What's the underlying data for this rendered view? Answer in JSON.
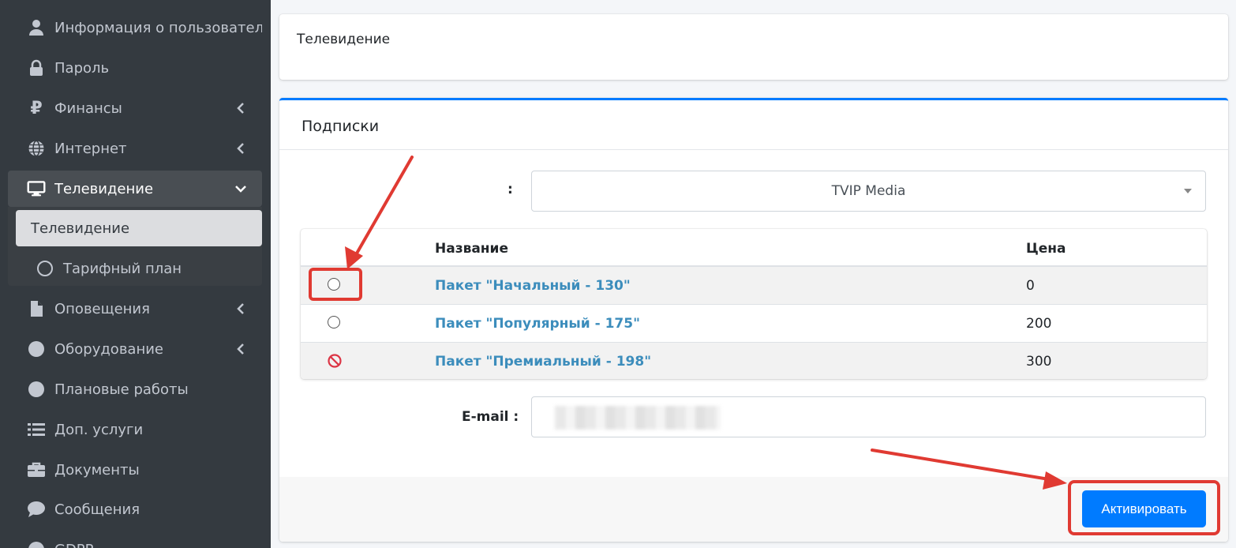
{
  "sidebar": {
    "items": [
      {
        "label": "Информация о пользователе",
        "icon": "user-icon",
        "has_chevron": false
      },
      {
        "label": "Пароль",
        "icon": "lock-icon",
        "has_chevron": false
      },
      {
        "label": "Финансы",
        "icon": "ruble-icon",
        "has_chevron": true
      },
      {
        "label": "Интернет",
        "icon": "globe-icon",
        "has_chevron": true
      },
      {
        "label": "Телевидение",
        "icon": "monitor-icon",
        "has_chevron": true,
        "expanded": true,
        "active": true
      },
      {
        "label": "Оповещения",
        "icon": "file-icon",
        "has_chevron": true
      },
      {
        "label": "Оборудование",
        "icon": "circle-icon",
        "has_chevron": true
      },
      {
        "label": "Плановые работы",
        "icon": "circle-icon",
        "has_chevron": false
      },
      {
        "label": "Доп. услуги",
        "icon": "list-icon",
        "has_chevron": false
      },
      {
        "label": "Документы",
        "icon": "briefcase-icon",
        "has_chevron": false
      },
      {
        "label": "Сообщения",
        "icon": "comment-icon",
        "has_chevron": false
      },
      {
        "label": "GDPR",
        "icon": "circle-icon",
        "has_chevron": false
      }
    ],
    "submenu": [
      {
        "label": "Телевидение",
        "active": true
      },
      {
        "label": "Тарифный план",
        "icon": "ring-icon"
      }
    ]
  },
  "breadcrumb_card": {
    "title": "Телевидение"
  },
  "subscriptions": {
    "title": "Подписки",
    "select_label": ":",
    "select_value": "TVIP Media",
    "table": {
      "headers": {
        "name": "Название",
        "price": "Цена"
      },
      "rows": [
        {
          "state": "radio",
          "name": "Пакет \"Начальный - 130\"",
          "price": "0"
        },
        {
          "state": "radio",
          "name": "Пакет \"Популярный - 175\"",
          "price": "200"
        },
        {
          "state": "blocked",
          "name": "Пакет \"Премиальный - 198\"",
          "price": "300"
        }
      ]
    },
    "email_label": "E-mail :",
    "email_value": "",
    "activate_label": "Активировать"
  },
  "colors": {
    "sidebar_bg": "#343a40",
    "accent": "#007bff",
    "link": "#3c8dbc",
    "annotation_red": "#e03a32"
  }
}
